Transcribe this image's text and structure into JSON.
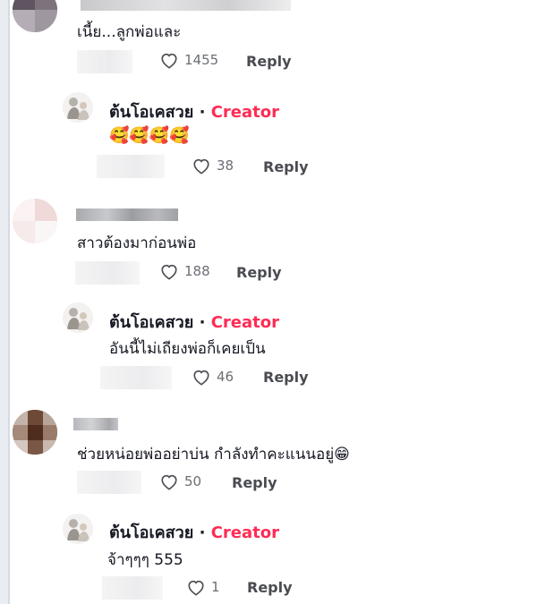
{
  "comments": [
    {
      "text": "เนี้ย...ลูกพ่อและ",
      "likes": "1455",
      "reply_label": "Reply",
      "reply": {
        "author": "ต้นโอเคสวย",
        "separator": "·",
        "badge": "Creator",
        "text": "🥰🥰🥰🥰",
        "likes": "38",
        "reply_label": "Reply"
      }
    },
    {
      "text": "สาวต้องมาก่อนพ่อ",
      "likes": "188",
      "reply_label": "Reply",
      "reply": {
        "author": "ต้นโอเคสวย",
        "separator": "·",
        "badge": "Creator",
        "text": "อันนี้ไม่เถียงพ่อก็เคยเป็น",
        "likes": "46",
        "reply_label": "Reply"
      }
    },
    {
      "text": "ช่วยหน่อยพ่ออย่าบ่น กำลังทำคะแนนอยู่😁",
      "likes": "50",
      "reply_label": "Reply",
      "reply": {
        "author": "ต้นโอเคสวย",
        "separator": "·",
        "badge": "Creator",
        "text": "จ้าๆๆๆ 555",
        "likes": "1",
        "reply_label": "Reply"
      }
    }
  ],
  "colors": {
    "creator_badge": "#fe2c55",
    "text": "#161823",
    "meta": "#6b6e75"
  },
  "icons": {
    "like": "heart-outline-icon"
  }
}
